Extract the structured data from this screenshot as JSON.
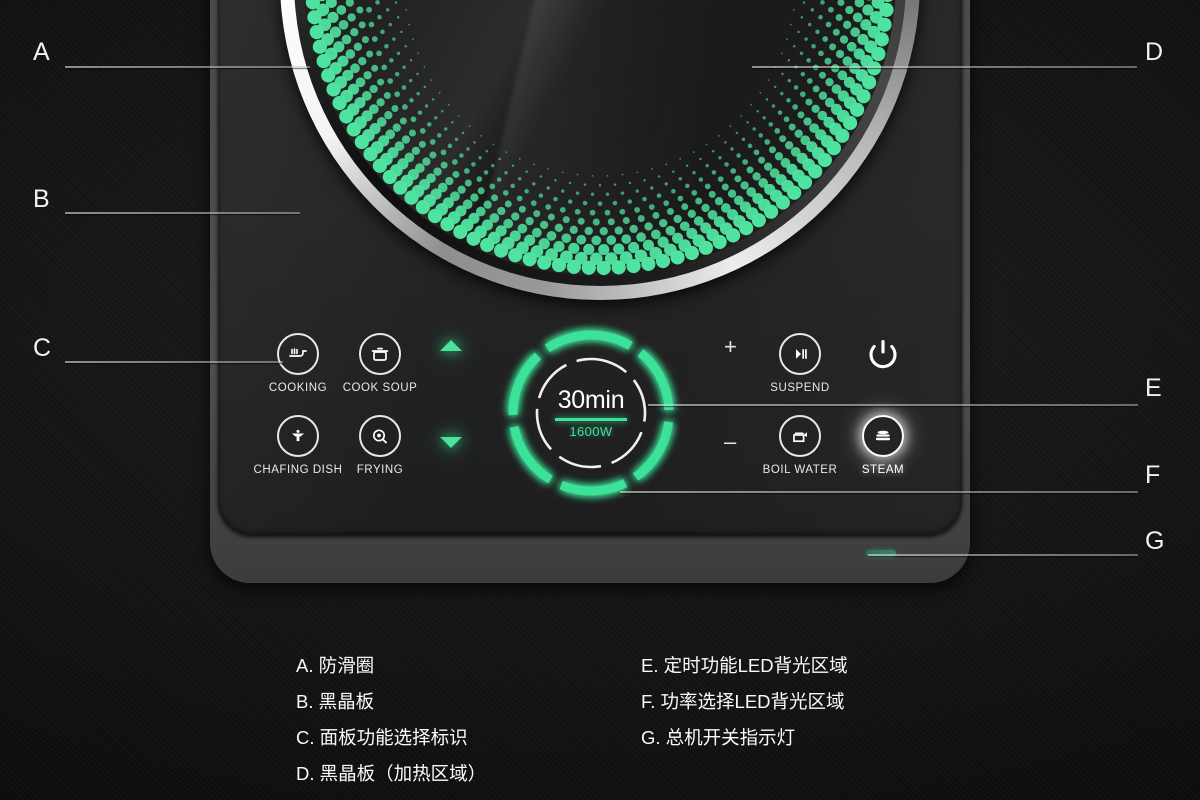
{
  "product": {
    "type": "induction-cooktop-diagram",
    "accent_green": "#3ce29a",
    "chrome": "#ffffff",
    "body_gray": "#4f4f4f",
    "glass_black": "#242424"
  },
  "display": {
    "time_value": "30min",
    "power_value": "1600W"
  },
  "controls": {
    "left": [
      {
        "id": "cooking",
        "label": "COOKING",
        "icon": "stove-grill-icon",
        "active": false
      },
      {
        "id": "cook-soup",
        "label": "COOK SOUP",
        "icon": "soup-pot-icon",
        "active": false
      },
      {
        "id": "chafing-dish",
        "label": "CHAFING DISH",
        "icon": "chafing-dish-icon",
        "active": false
      },
      {
        "id": "frying",
        "label": "FRYING",
        "icon": "frying-pan-icon",
        "active": false
      }
    ],
    "right": [
      {
        "id": "suspend",
        "label": "SUSPEND",
        "icon": "play-pause-icon",
        "active": false
      },
      {
        "id": "power",
        "label": "",
        "icon": "power-icon",
        "active": false
      },
      {
        "id": "boil-water",
        "label": "BOIL WATER",
        "icon": "kettle-icon",
        "active": false
      },
      {
        "id": "steam",
        "label": "STEAM",
        "icon": "steamer-icon",
        "active": true
      }
    ],
    "increment": "+",
    "decrement": "–",
    "arrow_up": "triangle-up-icon",
    "arrow_down": "triangle-down-icon"
  },
  "callouts": [
    {
      "key": "A",
      "label": "A"
    },
    {
      "key": "B",
      "label": "B"
    },
    {
      "key": "C",
      "label": "C"
    },
    {
      "key": "D",
      "label": "D"
    },
    {
      "key": "E",
      "label": "E"
    },
    {
      "key": "F",
      "label": "F"
    },
    {
      "key": "G",
      "label": "G"
    }
  ],
  "legend": {
    "column_left": [
      "A. 防滑圈",
      "B. 黑晶板",
      "C. 面板功能选择标识",
      "D. 黑晶板（加热区域）"
    ],
    "column_right": [
      "E. 定时功能LED背光区域",
      "F. 功率选择LED背光区域",
      "G. 总机开关指示灯"
    ]
  }
}
